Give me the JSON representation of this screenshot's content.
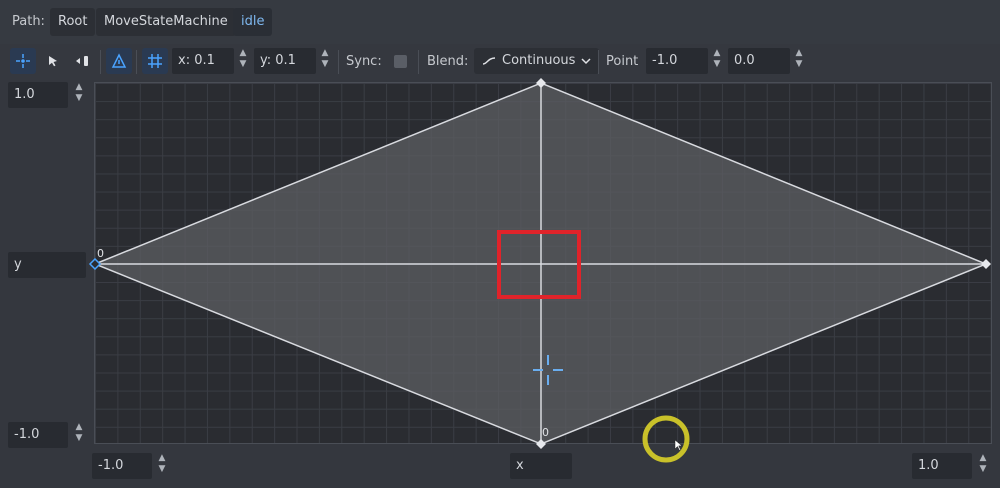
{
  "path_bar": {
    "label": "Path:",
    "crumbs": [
      "Root",
      "MoveStateMachine",
      "idle"
    ]
  },
  "toolbar": {
    "snap_x": "x: 0.1",
    "snap_y": "y: 0.1",
    "sync_label": "Sync:",
    "blend_label": "Blend:",
    "blend_mode": "Continuous",
    "point_label": "Point",
    "point_x": "-1.0",
    "point_y": "0.0"
  },
  "blend_space": {
    "y_max": "1.0",
    "y_min": "-1.0",
    "y_axis_name": "y",
    "x_min": "-1.0",
    "x_max": "1.0",
    "x_axis_name": "x",
    "left_point_index": "0",
    "bottom_point_index": "0"
  },
  "colors": {
    "accent": "#4aa3ff",
    "highlight": "#e0232a",
    "cursor_ring": "#c9c12a",
    "triangle_fill": "#5c5e62"
  }
}
